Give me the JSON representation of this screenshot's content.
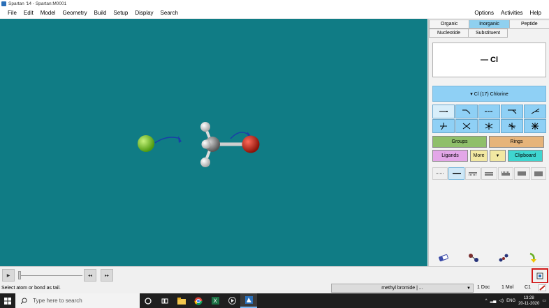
{
  "window": {
    "title": "Spartan '14 - Spartan:M0001"
  },
  "menu": {
    "left": [
      "File",
      "Edit",
      "Model",
      "Geometry",
      "Build",
      "Setup",
      "Display",
      "Search"
    ],
    "right": [
      "Options",
      "Activities",
      "Help"
    ]
  },
  "panel": {
    "tabs_row1": [
      "Organic",
      "Inorganic",
      "Peptide"
    ],
    "tabs_row2": [
      "Nucleotide",
      "Substituent"
    ],
    "active_tab": "Inorganic",
    "preview_text": "— Cl",
    "element_selector": "▾ Cl (17) Chlorine",
    "buttons": {
      "groups": "Groups",
      "rings": "Rings",
      "ligands": "Ligands",
      "more": "More",
      "clipboard": "Clipboard"
    },
    "colors": {
      "groups": "#8fbf6a",
      "rings": "#e6b47a",
      "ligands": "#e3a6e8",
      "more": "#f2e8a2",
      "clipboard": "#3fd6d0",
      "bond_blue": "#8fd0f5"
    }
  },
  "molecule": {
    "name": "methyl bromide",
    "atoms": [
      "chlorine-atom",
      "carbon-atom",
      "hydrogen-atom",
      "hydrogen-atom",
      "hydrogen-atom",
      "bromine-atom"
    ],
    "colors": {
      "chlorine": "#7ed321",
      "carbon": "#8a8a8a",
      "hydrogen": "#e8e8e8",
      "bromine": "#c0281c",
      "arrow": "#1a3fa8",
      "background": "#107c85"
    }
  },
  "status": {
    "message": "Select atom or bond as tail.",
    "document": "methyl bromide | ...",
    "doc_count": "1 Doc",
    "mol_count": "1 Mol",
    "symmetry": "C1"
  },
  "taskbar": {
    "search_placeholder": "Type here to search",
    "language": "ENG",
    "time": "13:28",
    "date": "20-11-2020"
  }
}
